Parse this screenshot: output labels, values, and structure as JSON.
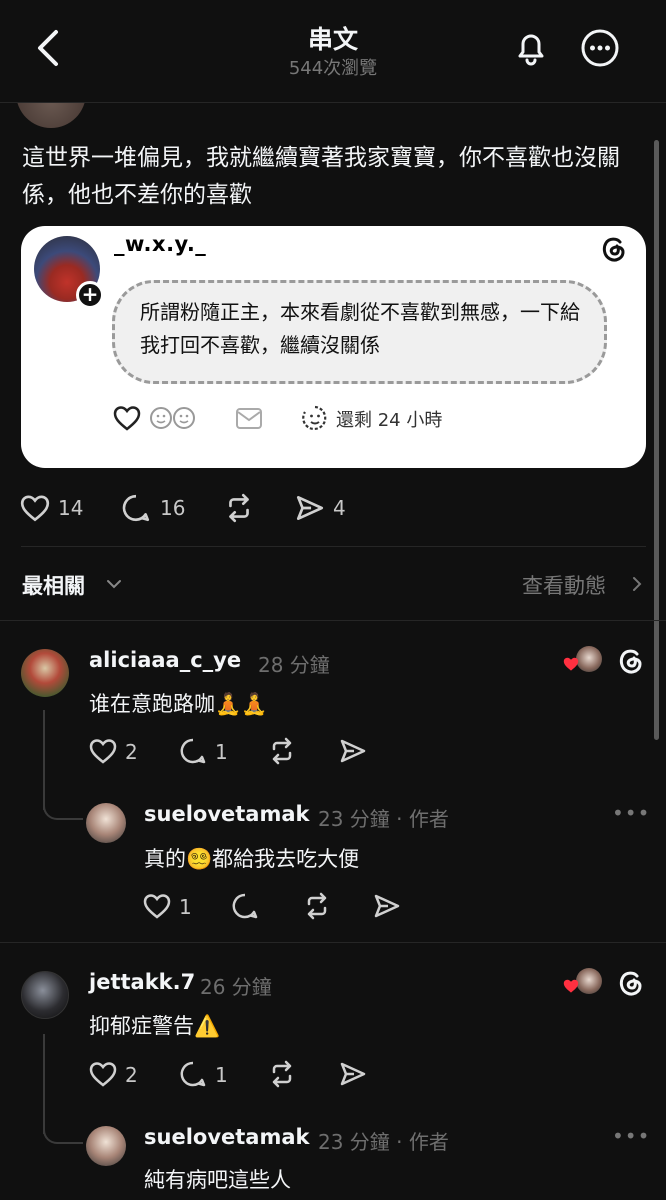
{
  "header": {
    "title": "串文",
    "views": "544次瀏覽"
  },
  "post": {
    "text": "這世界一堆偏見，我就繼續寶著我家寶寶，你不喜歡也沒關係，他也不差你的喜歡",
    "embed": {
      "username": "_w.x.y._",
      "text": "所謂粉隨正主，本來看劇從不喜歡到無感，一下給我打回不喜歡，繼續沒關係",
      "remaining": "還剩 24 小時"
    },
    "actions": {
      "likes": "14",
      "replies": "16",
      "shares": "4"
    }
  },
  "sort": {
    "label": "最相關",
    "activity": "查看動態"
  },
  "comments": [
    {
      "username": "aliciaaa_c_ye",
      "time": "28 分鐘",
      "text": "谁在意跑路咖",
      "text_emoji": "🧘🧘",
      "likes": "2",
      "replies": "1",
      "reply": {
        "username": "suelovetamak",
        "time": "23 分鐘",
        "author": "作者",
        "text_a": "真的",
        "text_emoji": "😵‍💫",
        "text_b": "都給我去吃大便",
        "likes": "1"
      }
    },
    {
      "username": "jettakk.7",
      "time": "26 分鐘",
      "text": "抑郁症警告",
      "text_emoji": "⚠️",
      "likes": "2",
      "replies": "1",
      "reply": {
        "username": "suelovetamak",
        "time": "23 分鐘",
        "author": "作者",
        "text": "純有病吧這些人"
      }
    }
  ],
  "icons": {
    "back": "chevron-left-icon",
    "bell": "bell-icon",
    "more": "more-circle-icon",
    "threads": "threads-logo-icon",
    "heart": "heart-icon",
    "reply": "reply-icon",
    "repost": "repost-icon",
    "share": "share-icon"
  },
  "colors": {
    "background": "#101010",
    "text": "#f3f5f7",
    "muted": "#6e6e6e",
    "like": "#ff3040"
  }
}
